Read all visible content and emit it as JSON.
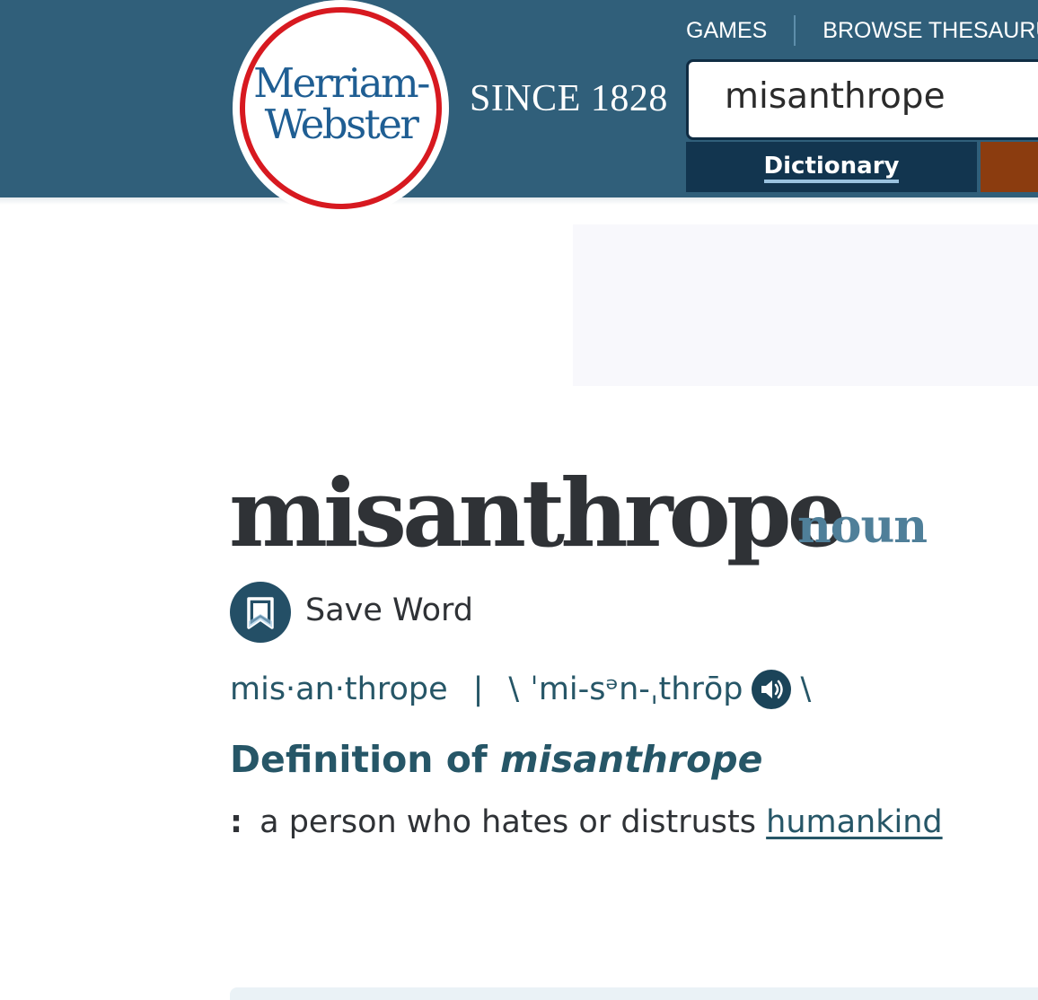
{
  "header": {
    "logo": {
      "line1": "Merriam-",
      "line2": "Webster"
    },
    "since": "SINCE 1828",
    "nav": {
      "games": "GAMES",
      "browse_thesaurus": "BROWSE THESAURUS"
    },
    "search": {
      "value": "misanthrope"
    },
    "tabs": {
      "dictionary": "Dictionary"
    }
  },
  "entry": {
    "headword": "misanthrope",
    "part_of_speech": "noun",
    "save_label": "Save Word",
    "syllables": "mis·an·thrope",
    "separator": "|",
    "pron_open": "\\",
    "pronunciation": "ˈmi-sᵊn-ˌthrōp",
    "pron_close": "\\",
    "definition_heading_prefix": "Definition of",
    "definition_heading_word": "misanthrope",
    "definition_colon": ":",
    "definition_text": "a person who hates or distrusts",
    "definition_link": "humankind"
  },
  "colors": {
    "header_bg": "#305f7a",
    "logo_ring": "#d71920",
    "logo_text": "#1f5e93",
    "tab_dictionary_bg": "#12354f",
    "tab_thesaurus_bg": "#8b3c0f",
    "accent_text": "#265667",
    "pos_text": "#4f7f99"
  },
  "icons": {
    "save": "bookmark-icon",
    "audio": "speaker-icon"
  }
}
